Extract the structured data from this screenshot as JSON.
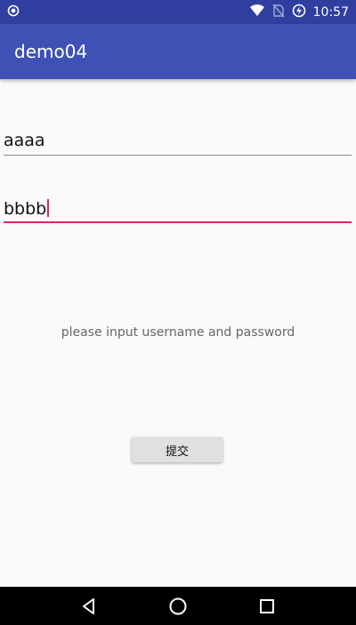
{
  "status_bar": {
    "time": "10:57",
    "icons": [
      "notification-dot-icon",
      "wifi-icon",
      "no-sim-icon",
      "battery-saver-icon"
    ]
  },
  "app_bar": {
    "title": "demo04"
  },
  "form": {
    "username_value": "aaaa",
    "password_value": "bbbb",
    "hint": "please input username and password",
    "submit_label": "提交"
  },
  "nav_bar": {
    "icons": [
      "back-icon",
      "home-icon",
      "recents-icon"
    ]
  },
  "colors": {
    "status_bar": "#303f9f",
    "app_bar": "#3f51b5",
    "accent": "#e91e63",
    "background": "#fafafa"
  }
}
